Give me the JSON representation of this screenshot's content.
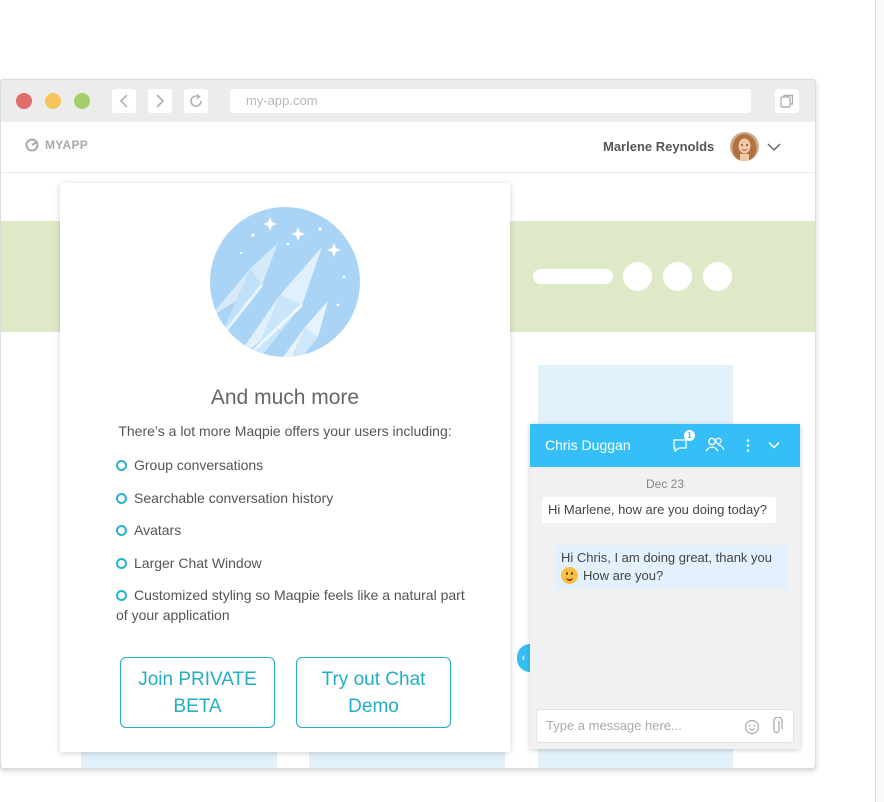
{
  "browser": {
    "url_placeholder": "my-app.com",
    "traffic_lights": {
      "close": "#e06c6c",
      "minimize": "#f6c55d",
      "maximize": "#a4cf6a"
    }
  },
  "app": {
    "logo_text": "MYAPP",
    "user_name": "Marlene Reynolds"
  },
  "card": {
    "title": "And much more",
    "subtitle": "There’s a lot more Maqpie offers your users including:",
    "features": [
      "Group conversations",
      "Searchable conversation history",
      "Avatars",
      "Larger Chat Window",
      "Customized styling so Maqpie feels like a natural part of your application"
    ],
    "buttons": {
      "beta": "Join PRIVATE BETA",
      "demo": "Try out Chat Demo"
    }
  },
  "chat": {
    "contact_name": "Chris Duggan",
    "unread_count": "1",
    "date": "Dec 23",
    "messages": [
      {
        "from": "contact",
        "text": "Hi Marlene, how are you doing today?"
      },
      {
        "from": "me",
        "text_before": "Hi Chris, I am doing great, thank you",
        "text_after": "How are you?"
      }
    ],
    "input_placeholder": "Type a message here...",
    "accent": "#36bff7"
  },
  "colors": {
    "banner": "#dde9c7",
    "teal_accent": "#22aec4",
    "light_blue": "#e1f1fc"
  }
}
